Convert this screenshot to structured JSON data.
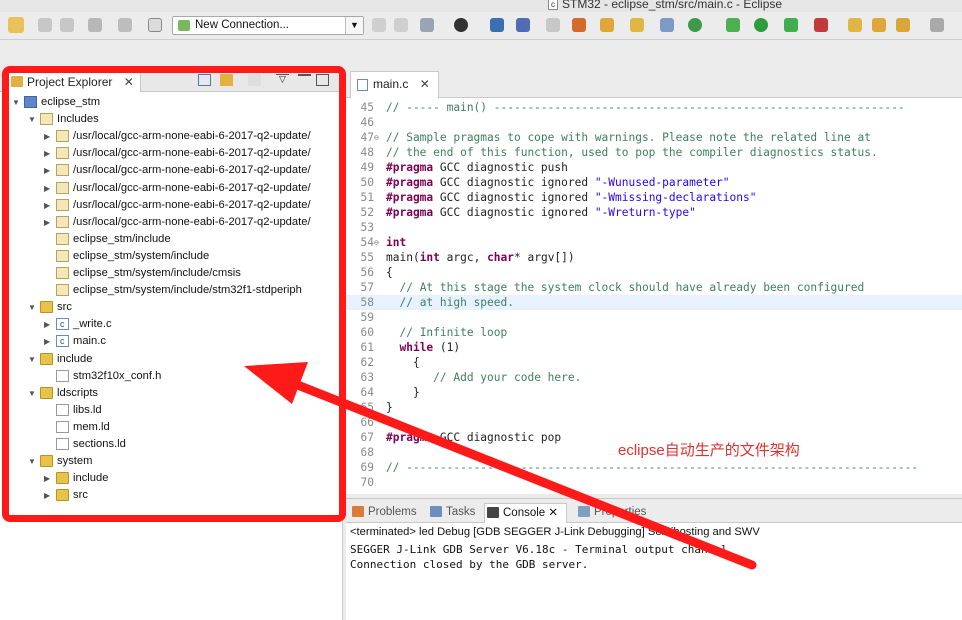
{
  "window": {
    "title": "STM32 - eclipse_stm/src/main.c - Eclipse"
  },
  "toolbar": {
    "connection_label": "New Connection..."
  },
  "explorer": {
    "tab_label": "Project Explorer",
    "close_glyph": "✕",
    "items": [
      {
        "label": "eclipse_stm",
        "depth": 0,
        "twisty": "▼",
        "icon": "project"
      },
      {
        "label": "Includes",
        "depth": 1,
        "twisty": "▼",
        "icon": "includes"
      },
      {
        "label": "/usr/local/gcc-arm-none-eabi-6-2017-q2-update/",
        "depth": 2,
        "twisty": "▶",
        "icon": "include-folder"
      },
      {
        "label": "/usr/local/gcc-arm-none-eabi-6-2017-q2-update/",
        "depth": 2,
        "twisty": "▶",
        "icon": "include-folder"
      },
      {
        "label": "/usr/local/gcc-arm-none-eabi-6-2017-q2-update/",
        "depth": 2,
        "twisty": "▶",
        "icon": "include-folder"
      },
      {
        "label": "/usr/local/gcc-arm-none-eabi-6-2017-q2-update/",
        "depth": 2,
        "twisty": "▶",
        "icon": "include-folder"
      },
      {
        "label": "/usr/local/gcc-arm-none-eabi-6-2017-q2-update/",
        "depth": 2,
        "twisty": "▶",
        "icon": "include-folder"
      },
      {
        "label": "/usr/local/gcc-arm-none-eabi-6-2017-q2-update/",
        "depth": 2,
        "twisty": "▶",
        "icon": "include-folder"
      },
      {
        "label": "eclipse_stm/include",
        "depth": 2,
        "twisty": "",
        "icon": "include-folder"
      },
      {
        "label": "eclipse_stm/system/include",
        "depth": 2,
        "twisty": "",
        "icon": "include-folder"
      },
      {
        "label": "eclipse_stm/system/include/cmsis",
        "depth": 2,
        "twisty": "",
        "icon": "include-folder"
      },
      {
        "label": "eclipse_stm/system/include/stm32f1-stdperiph",
        "depth": 2,
        "twisty": "",
        "icon": "include-folder"
      },
      {
        "label": "src",
        "depth": 1,
        "twisty": "▼",
        "icon": "folder"
      },
      {
        "label": "_write.c",
        "depth": 2,
        "twisty": "▶",
        "icon": "c-file"
      },
      {
        "label": "main.c",
        "depth": 2,
        "twisty": "▶",
        "icon": "c-file"
      },
      {
        "label": "include",
        "depth": 1,
        "twisty": "▼",
        "icon": "folder"
      },
      {
        "label": "stm32f10x_conf.h",
        "depth": 2,
        "twisty": "",
        "icon": "h-file"
      },
      {
        "label": "ldscripts",
        "depth": 1,
        "twisty": "▼",
        "icon": "folder"
      },
      {
        "label": "libs.ld",
        "depth": 2,
        "twisty": "",
        "icon": "ld-file"
      },
      {
        "label": "mem.ld",
        "depth": 2,
        "twisty": "",
        "icon": "ld-file"
      },
      {
        "label": "sections.ld",
        "depth": 2,
        "twisty": "",
        "icon": "ld-file"
      },
      {
        "label": "system",
        "depth": 1,
        "twisty": "▼",
        "icon": "folder"
      },
      {
        "label": "include",
        "depth": 2,
        "twisty": "▶",
        "icon": "folder"
      },
      {
        "label": "src",
        "depth": 2,
        "twisty": "▶",
        "icon": "folder"
      }
    ]
  },
  "editor": {
    "tab_label": "main.c",
    "close_glyph": "✕",
    "lines": [
      {
        "num": "45",
        "fold": "",
        "text": "// ----- main() -------------------------------------------------------------",
        "hl": false
      },
      {
        "num": "46",
        "fold": "",
        "text": "",
        "hl": false
      },
      {
        "num": "47",
        "fold": "⊖",
        "text": "// Sample pragmas to cope with warnings. Please note the related line at",
        "hl": false
      },
      {
        "num": "48",
        "fold": "",
        "text": "// the end of this function, used to pop the compiler diagnostics status.",
        "hl": false
      },
      {
        "num": "49",
        "fold": "",
        "text": "#pragma GCC diagnostic push",
        "hl": false
      },
      {
        "num": "50",
        "fold": "",
        "text": "#pragma GCC diagnostic ignored \"-Wunused-parameter\"",
        "hl": false
      },
      {
        "num": "51",
        "fold": "",
        "text": "#pragma GCC diagnostic ignored \"-Wmissing-declarations\"",
        "hl": false
      },
      {
        "num": "52",
        "fold": "",
        "text": "#pragma GCC diagnostic ignored \"-Wreturn-type\"",
        "hl": false
      },
      {
        "num": "53",
        "fold": "",
        "text": "",
        "hl": false
      },
      {
        "num": "54",
        "fold": "⊖",
        "text": "int",
        "hl": false
      },
      {
        "num": "55",
        "fold": "",
        "text": "main(int argc, char* argv[])",
        "hl": false
      },
      {
        "num": "56",
        "fold": "",
        "text": "{",
        "hl": false
      },
      {
        "num": "57",
        "fold": "",
        "text": "  // At this stage the system clock should have already been configured",
        "hl": false
      },
      {
        "num": "58",
        "fold": "",
        "text": "  // at high speed.",
        "hl": true
      },
      {
        "num": "59",
        "fold": "",
        "text": "",
        "hl": false
      },
      {
        "num": "60",
        "fold": "",
        "text": "  // Infinite loop",
        "hl": false
      },
      {
        "num": "61",
        "fold": "",
        "text": "  while (1)",
        "hl": false
      },
      {
        "num": "62",
        "fold": "",
        "text": "    {",
        "hl": false
      },
      {
        "num": "63",
        "fold": "",
        "text": "       // Add your code here.",
        "hl": false
      },
      {
        "num": "64",
        "fold": "",
        "text": "    }",
        "hl": false
      },
      {
        "num": "65",
        "fold": "",
        "text": "}",
        "hl": false
      },
      {
        "num": "66",
        "fold": "",
        "text": "",
        "hl": false
      },
      {
        "num": "67",
        "fold": "",
        "text": "#pragma GCC diagnostic pop",
        "hl": false
      },
      {
        "num": "68",
        "fold": "",
        "text": "",
        "hl": false
      },
      {
        "num": "69",
        "fold": "",
        "text": "// ----------------------------------------------------------------------------",
        "hl": false
      },
      {
        "num": "70",
        "fold": "",
        "text": "",
        "hl": false
      }
    ],
    "annotation": "eclipse自动生产的文件架构"
  },
  "console": {
    "tabs": [
      {
        "label": "Problems",
        "active": false,
        "color": "#d97b3a"
      },
      {
        "label": "Tasks",
        "active": false,
        "color": "#6c8fbf"
      },
      {
        "label": "Console",
        "active": true,
        "color": "#444444"
      },
      {
        "label": "Properties",
        "active": false,
        "color": "#7f9fbf"
      }
    ],
    "close_glyph": "✕",
    "status": "<terminated> led Debug [GDB SEGGER J-Link Debugging] Semihosting and SWV",
    "lines": [
      "SEGGER J-Link GDB Server V6.18c - Terminal output channel",
      "Connection closed by the GDB server."
    ]
  },
  "colors": {
    "highlight_box": "#ff1a1a",
    "annotation": "#e03030"
  }
}
